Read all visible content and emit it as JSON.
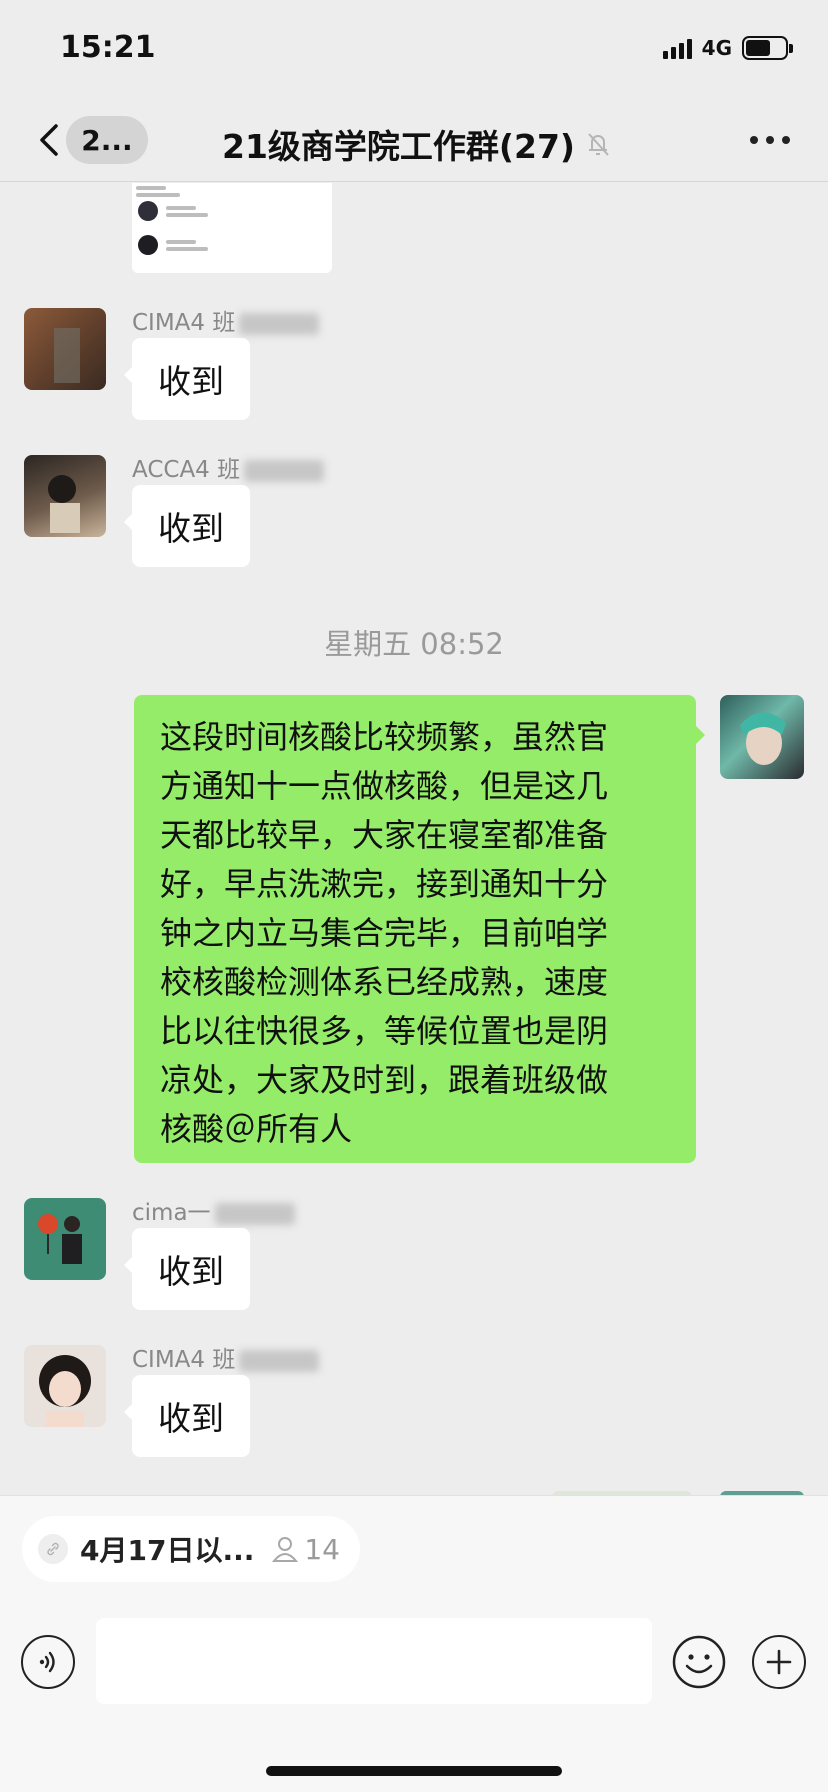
{
  "status_bar": {
    "time": "15:21",
    "network": "4G"
  },
  "nav": {
    "back_badge": "2...",
    "title": "21级商学院工作群(27)",
    "icons": [
      "back-arrow-icon",
      "mute-bell-icon",
      "more-dots-icon"
    ]
  },
  "chat": {
    "messages": [
      {
        "sender": "CIMA4 班",
        "text": "收到"
      },
      {
        "sender": "ACCA4 班",
        "text": "收到"
      },
      {
        "sender": "cima一",
        "text": "收到"
      },
      {
        "sender": "CIMA4 班",
        "text": "收到"
      }
    ],
    "time_label": "星期五 08:52",
    "my_message": {
      "lines": [
        "这段时间核酸比较频繁，虽然官",
        "方通知十一点做核酸，但是这几",
        "天都比较早，大家在寝室都准备",
        "好，早点洗漱完，接到通知十分",
        "钟之内立马集合完毕，目前咱学",
        "校核酸检测体系已经成熟，速度",
        "比以往快很多，等候位置也是阴",
        "凉处，大家及时到，跟着班级做",
        "核酸＠所有人"
      ]
    }
  },
  "bottom": {
    "quote_text": "4月17日以...",
    "quote_count": "14",
    "input_value": "",
    "icons": [
      "voice-icon",
      "emoji-icon",
      "plus-icon"
    ]
  },
  "colors": {
    "background": "#ededed",
    "my_bubble": "#95ec69",
    "other_bubble": "#ffffff"
  }
}
